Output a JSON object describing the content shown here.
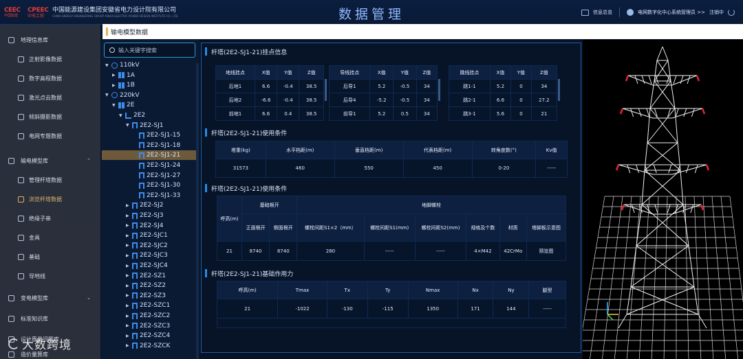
{
  "header": {
    "logo1_top": "CEEC",
    "logo1_bottom": "中国能建",
    "logo2_top": "CPEEC",
    "logo2_bottom": "中电工程",
    "org_name": "中国能源建设集团安徽省电力设计院有限公司",
    "org_en": "CHINA ENERGY ENGINEERING GROUP ANHUI ELECTRIC POWER DESIGN INSTITUTE CO., LTD.",
    "title": "数据管理",
    "messages_label": "信息总览",
    "user_label": "电网数字化中心系统管理员 >>",
    "logout_label": "注销中"
  },
  "breadcrumb": "输电模型数据",
  "nav": [
    {
      "label": "地理信息库",
      "level": "top",
      "chev": ""
    },
    {
      "label": "正射影像数据",
      "level": "sub"
    },
    {
      "label": "数字高程数据",
      "level": "sub"
    },
    {
      "label": "激光点云数据",
      "level": "sub"
    },
    {
      "label": "倾斜摄影数据",
      "level": "sub"
    },
    {
      "label": "电网专题数据",
      "level": "sub"
    },
    {
      "label": "输电模型库",
      "level": "top",
      "chev": "^"
    },
    {
      "label": "管理杆塔数据",
      "level": "sub"
    },
    {
      "label": "浏览杆塔数据",
      "level": "sub",
      "active": true
    },
    {
      "label": "绝缘子串",
      "level": "sub"
    },
    {
      "label": "金具",
      "level": "sub"
    },
    {
      "label": "基础",
      "level": "sub"
    },
    {
      "label": "导地线",
      "level": "sub"
    },
    {
      "label": "变电模型库",
      "level": "top",
      "chev": "v"
    },
    {
      "label": "标准知识库",
      "level": "top",
      "chev": ""
    },
    {
      "label": "设计质量问题库",
      "level": "top",
      "chev": ""
    },
    {
      "label": "造价量算库",
      "level": "top",
      "chev": ""
    }
  ],
  "tree": {
    "search_placeholder": "输入关键字搜索",
    "nodes": [
      {
        "label": "110kV",
        "indent": 0,
        "arrow": "▼",
        "icon": "volt"
      },
      {
        "label": "1A",
        "indent": 1,
        "arrow": "▶",
        "icon": "grid"
      },
      {
        "label": "1B",
        "indent": 1,
        "arrow": "▶",
        "icon": "grid"
      },
      {
        "label": "220kV",
        "indent": 0,
        "arrow": "▼",
        "icon": "volt"
      },
      {
        "label": "2E",
        "indent": 1,
        "arrow": "▼",
        "icon": "grid"
      },
      {
        "label": "2E2",
        "indent": 2,
        "arrow": "▼",
        "icon": "branch"
      },
      {
        "label": "2E2-SJ1",
        "indent": 3,
        "arrow": "▼",
        "icon": "tower"
      },
      {
        "label": "2E2-SJ1-15",
        "indent": 4,
        "arrow": "",
        "icon": "tower"
      },
      {
        "label": "2E2-SJ1-18",
        "indent": 4,
        "arrow": "",
        "icon": "tower"
      },
      {
        "label": "2E2-SJ1-21",
        "indent": 4,
        "arrow": "",
        "icon": "tower",
        "selected": true
      },
      {
        "label": "2E2-SJ1-24",
        "indent": 4,
        "arrow": "",
        "icon": "tower"
      },
      {
        "label": "2E2-SJ1-27",
        "indent": 4,
        "arrow": "",
        "icon": "tower"
      },
      {
        "label": "2E2-SJ1-30",
        "indent": 4,
        "arrow": "",
        "icon": "tower"
      },
      {
        "label": "2E2-SJ1-33",
        "indent": 4,
        "arrow": "",
        "icon": "tower"
      },
      {
        "label": "2E2-SJ2",
        "indent": 3,
        "arrow": "▶",
        "icon": "tower"
      },
      {
        "label": "2E2-SJ3",
        "indent": 3,
        "arrow": "▶",
        "icon": "tower"
      },
      {
        "label": "2E2-SJ4",
        "indent": 3,
        "arrow": "▶",
        "icon": "tower"
      },
      {
        "label": "2E2-SJC1",
        "indent": 3,
        "arrow": "▶",
        "icon": "tower"
      },
      {
        "label": "2E2-SJC2",
        "indent": 3,
        "arrow": "▶",
        "icon": "tower"
      },
      {
        "label": "2E2-SJC3",
        "indent": 3,
        "arrow": "▶",
        "icon": "tower"
      },
      {
        "label": "2E2-SJC4",
        "indent": 3,
        "arrow": "▶",
        "icon": "tower"
      },
      {
        "label": "2E2-SZ1",
        "indent": 3,
        "arrow": "▶",
        "icon": "tower"
      },
      {
        "label": "2E2-SZ2",
        "indent": 3,
        "arrow": "▶",
        "icon": "tower"
      },
      {
        "label": "2E2-SZ3",
        "indent": 3,
        "arrow": "▶",
        "icon": "tower"
      },
      {
        "label": "2E2-SZC1",
        "indent": 3,
        "arrow": "▶",
        "icon": "tower"
      },
      {
        "label": "2E2-SZC2",
        "indent": 3,
        "arrow": "▶",
        "icon": "tower"
      },
      {
        "label": "2E2-SZC3",
        "indent": 3,
        "arrow": "▶",
        "icon": "tower"
      },
      {
        "label": "2E2-SZC4",
        "indent": 3,
        "arrow": "▶",
        "icon": "tower"
      },
      {
        "label": "2E2-SZCK",
        "indent": 3,
        "arrow": "▶",
        "icon": "tower"
      }
    ]
  },
  "sections": {
    "hang_points": {
      "title": "杆塔(2E2-SJ1-21)挂点信息",
      "tables": [
        {
          "headers": [
            "地线挂点",
            "X值",
            "Y值",
            "Z值"
          ],
          "rows": [
            [
              "后地1",
              "6.6",
              "-0.4",
              "38.5"
            ],
            [
              "后地2",
              "-6.6",
              "-0.4",
              "38.5"
            ],
            [
              "前地1",
              "6.6",
              "0.4",
              "38.5"
            ]
          ]
        },
        {
          "headers": [
            "导线挂点",
            "X值",
            "Y值",
            "Z值"
          ],
          "rows": [
            [
              "后导1",
              "5.2",
              "-0.5",
              "34"
            ],
            [
              "后导4",
              "-5.2",
              "-0.5",
              "34"
            ],
            [
              "前导1",
              "5.2",
              "0.5",
              "34"
            ]
          ]
        },
        {
          "headers": [
            "跳线挂点",
            "X值",
            "Y值",
            "Z值"
          ],
          "rows": [
            [
              "跳1-1",
              "5.2",
              "0",
              "34"
            ],
            [
              "跳2-1",
              "6.6",
              "0",
              "27.2"
            ],
            [
              "跳3-1",
              "5.6",
              "0",
              "21"
            ]
          ]
        }
      ]
    },
    "usage": {
      "title": "杆塔(2E2-SJ1-21)使用条件",
      "headers": [
        "塔重(kg)",
        "水平档距(m)",
        "垂直档距(m)",
        "代表档距(m)",
        "转角度数(°)",
        "Kv值"
      ],
      "row": [
        "31573",
        "460",
        "550",
        "450",
        "0-20",
        "-----"
      ]
    },
    "foundation_usage": {
      "title": "杆塔(2E2-SJ1-21)使用条件",
      "h_height": "呼高(m)",
      "h_group1": "基础根开",
      "h_group2": "地脚螺栓",
      "sub_headers": [
        "正面根开",
        "侧面根开",
        "螺栓间距S1×2（mm）",
        "螺栓间距S1(mm)",
        "螺栓间距S2(mm)",
        "规格及个数",
        "材质",
        "塔脚板示意图"
      ],
      "row": [
        "21",
        "8740",
        "8740",
        "280",
        "-----",
        "-----",
        "4×M42",
        "42CrMo",
        "预览图"
      ]
    },
    "forces": {
      "title": "杆塔(2E2-SJ1-21)基础作用力",
      "headers": [
        "呼高(m)",
        "Tmax",
        "Tx",
        "Ty",
        "Nmax",
        "Nx",
        "Ny",
        "腿型"
      ],
      "row": [
        "21",
        "-1022",
        "-130",
        "-115",
        "1350",
        "171",
        "144",
        "-----"
      ]
    }
  },
  "watermark": "大数跨境"
}
